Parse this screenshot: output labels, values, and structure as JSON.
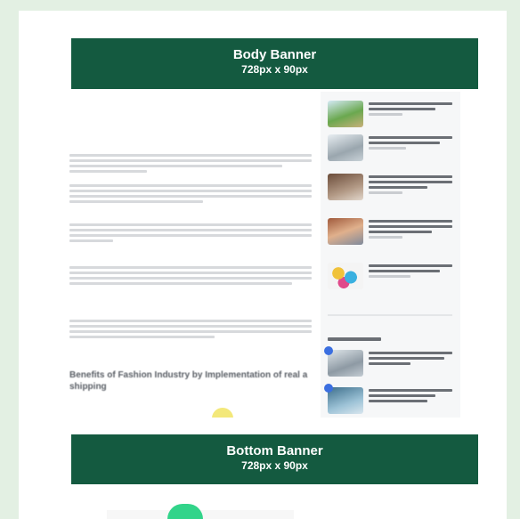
{
  "banners": {
    "body": {
      "title": "Body Banner",
      "size": "728px x 90px"
    },
    "bottom": {
      "title": "Bottom Banner",
      "size": "728px x 90px"
    }
  },
  "article": {
    "heading": "Benefits of Fashion Industry by Implementation of real a shipping"
  },
  "colors": {
    "page_bg": "#e3f0e3",
    "banner_bg": "#145a40",
    "banner_text": "#ffffff",
    "badge": "#3b6fe0",
    "accent_green": "#32d48a"
  }
}
